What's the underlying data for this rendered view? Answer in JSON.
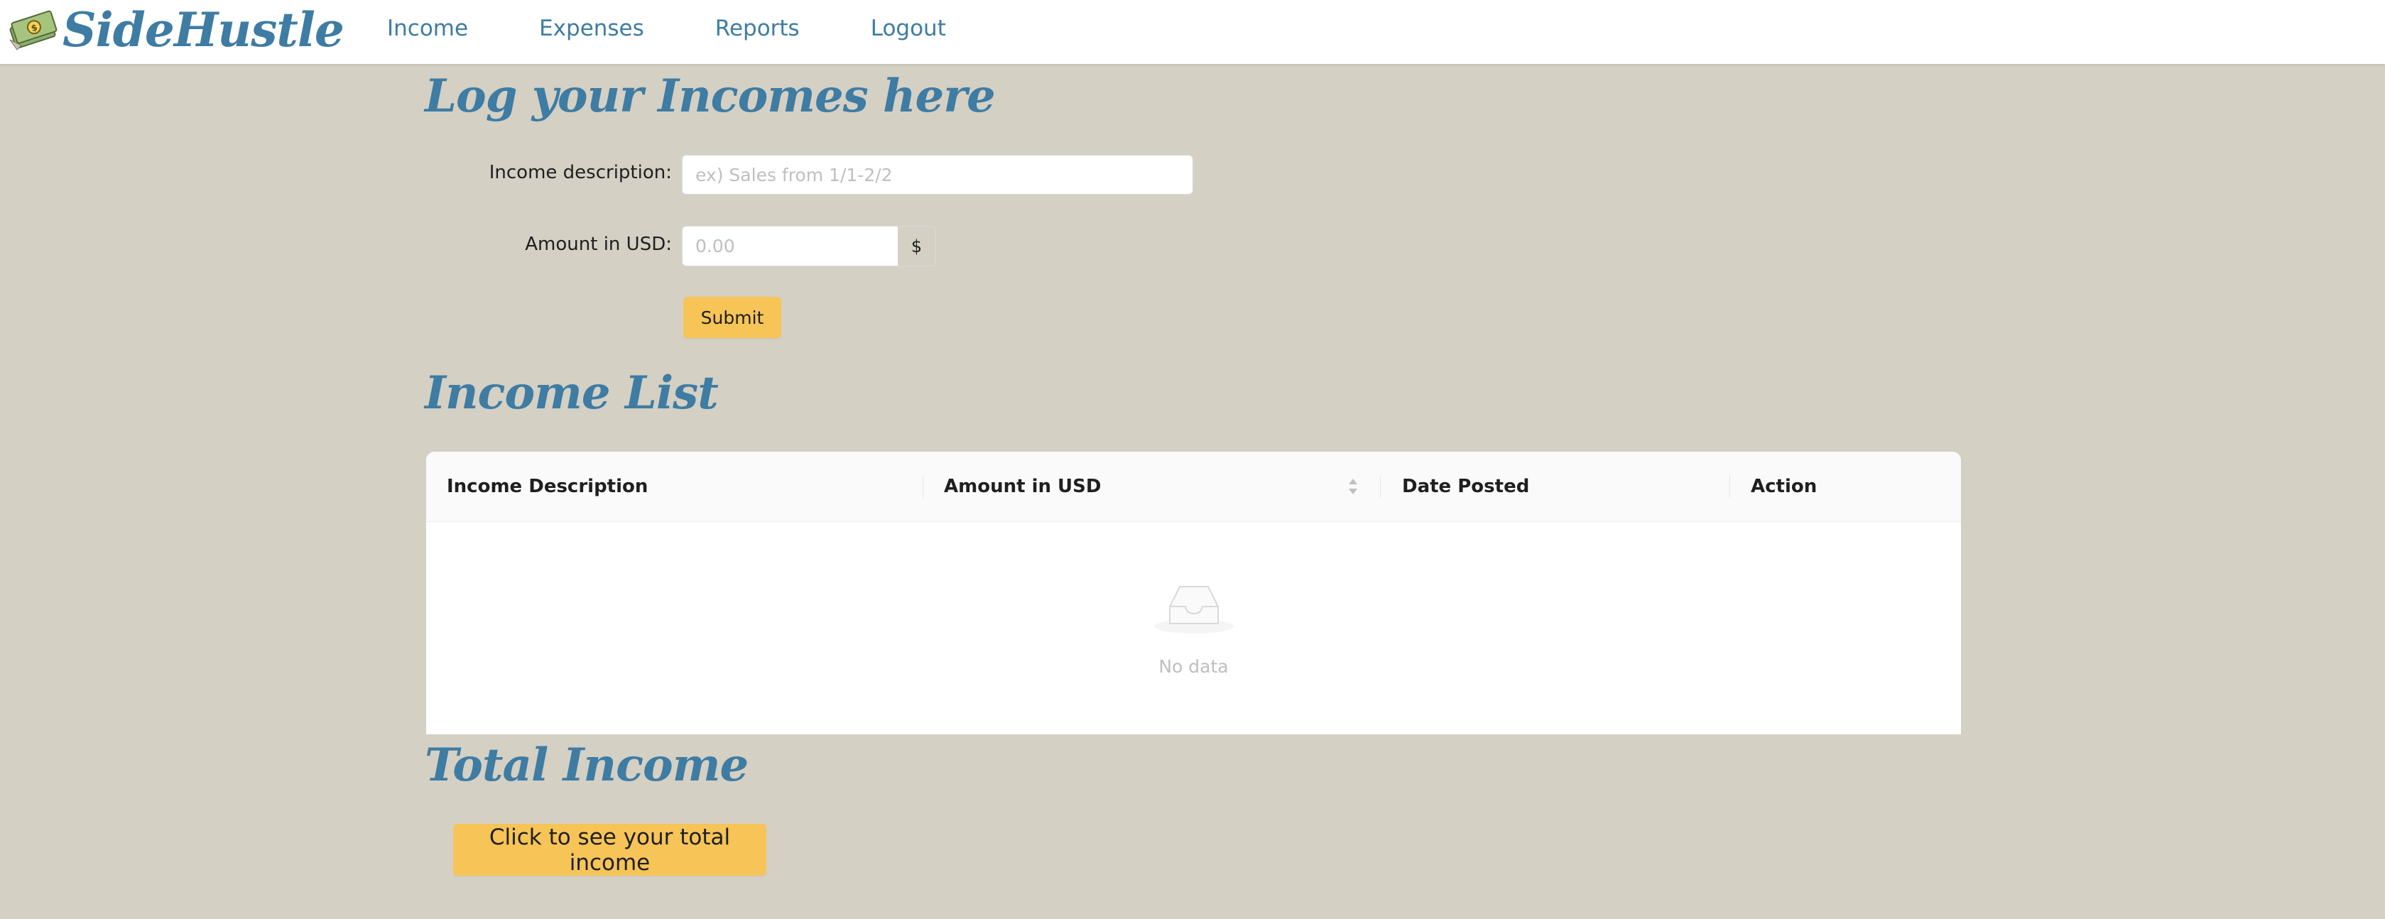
{
  "app": {
    "brand": "SideHustle"
  },
  "nav": {
    "items": [
      "Income",
      "Expenses",
      "Reports",
      "Logout"
    ]
  },
  "log_section": {
    "title": "Log your Incomes here",
    "description_label": "Income description",
    "description_placeholder": "ex) Sales from 1/1-2/2",
    "description_value": "",
    "amount_label": "Amount in USD",
    "amount_placeholder": "0.00",
    "amount_value": "",
    "currency_addon": "$",
    "submit_label": "Submit"
  },
  "list_section": {
    "title": "Income List",
    "columns": [
      "Income Description",
      "Amount in USD",
      "Date Posted",
      "Action"
    ],
    "rows": [],
    "empty_text": "No data"
  },
  "total_section": {
    "title": "Total Income",
    "button_label": "Click to see your total income"
  },
  "colors": {
    "background": "#d4d0c4",
    "brand_blue": "#3e7ca3",
    "button_yellow": "#f6c457"
  }
}
